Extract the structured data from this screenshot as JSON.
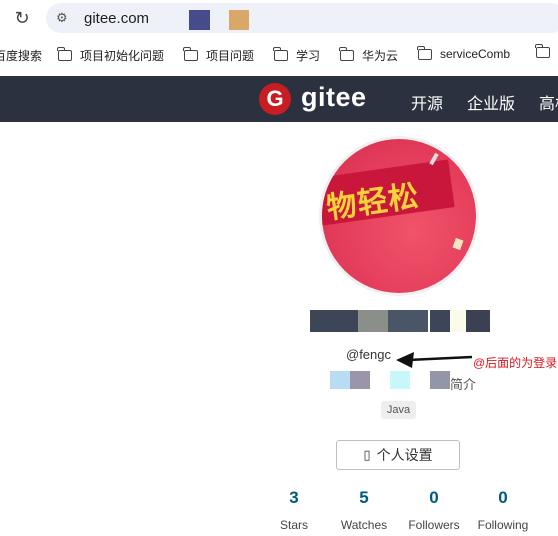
{
  "browser": {
    "url": "gitee.com",
    "bookmarks": [
      {
        "label": "百度搜索",
        "folder": false
      },
      {
        "label": "项目初始化问题",
        "folder": true
      },
      {
        "label": "项目问题",
        "folder": true
      },
      {
        "label": "学习",
        "folder": true
      },
      {
        "label": "华为云",
        "folder": true
      },
      {
        "label": "serviceComb",
        "folder": true
      }
    ]
  },
  "nav": {
    "logo_badge": "G",
    "logo_text": "gitee",
    "items": [
      "开源",
      "企业版",
      "高校"
    ]
  },
  "profile": {
    "avatar_text": "物轻松",
    "handle": "@fengc",
    "annotation": "@后面的为登录名",
    "bio_suffix": "简介",
    "tag": "Java",
    "settings_icon": "▯",
    "settings_label": "个人设置",
    "stats": [
      {
        "value": "3",
        "label": "Stars"
      },
      {
        "value": "5",
        "label": "Watches"
      },
      {
        "value": "0",
        "label": "Followers"
      },
      {
        "value": "0",
        "label": "Following"
      }
    ],
    "colors": {
      "stat_number": "#005980",
      "annotation": "#d71920",
      "navbar": "#2b313f",
      "brand": "#c71d23"
    }
  }
}
